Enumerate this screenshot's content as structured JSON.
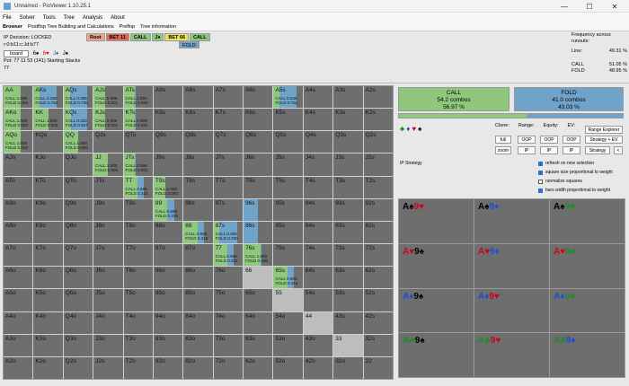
{
  "window": {
    "title": "Unnamed - PioViewer 1.10.25.1",
    "min": "—",
    "max": "☐",
    "close": "✕"
  },
  "menu": [
    "File",
    "Solver",
    "Tools",
    "Tree",
    "Analysis",
    "About"
  ],
  "tabs": [
    "Browser",
    "Postflop Tree Building and Calculations",
    "Preflop",
    "Tree information"
  ],
  "info": {
    "ip_decision": "IP Decision: LOCKED",
    "board_code": "r:0:b11:c:Jd:b77",
    "board_button": "board",
    "suit_codes": [
      "6♠",
      "6♥",
      "J♦",
      "J♠"
    ],
    "pot": "Pot: 77 11 53 (141) Starting Stacks 77"
  },
  "nodes": [
    {
      "label": "Root",
      "color": "#e8a58a"
    },
    {
      "label": "BET 11",
      "color": "#e36a5a"
    },
    {
      "label": "CALL",
      "color": "#8fc77d"
    },
    {
      "label": "J♦",
      "color": "#8fc77d"
    },
    {
      "label": "BET 66",
      "color": "#e8e35a"
    },
    {
      "label": "CALL",
      "color": "#8fc77d"
    }
  ],
  "fold_node": "FOLD",
  "frequency": {
    "title": "Frequency across runouts:",
    "line_label": "Line:",
    "line_val": "49.31 %",
    "call_label": "CALL",
    "call_val": "51.05 %",
    "fold_label": "FOLD",
    "fold_val": "48.95 %"
  },
  "summary": {
    "call_title": "CALL",
    "call_combos": "54.2 combos",
    "call_pct": "56.97 %",
    "fold_title": "FOLD",
    "fold_combos": "41.0 combos",
    "fold_pct": "43.03 %",
    "call_fraction": 0.5697
  },
  "controls": {
    "labels": [
      "Clone:",
      "Range:",
      "Equity:",
      "EV:"
    ],
    "full": "full",
    "zoom": "zoom",
    "oop1": "OOP",
    "oop2": "OOP",
    "oop3": "OOP",
    "ip1": "IP",
    "ip2": "IP",
    "ip3": "IP",
    "range_explorer": "Range Explorer",
    "strategy_ev": "Strategy + EV",
    "strategy": "Strategy",
    "lt": "<",
    "ip_strategy": "IP Strategy",
    "checkboxes": [
      {
        "label": "refresh on new selection",
        "on": true
      },
      {
        "label": "square size proportional to weight",
        "on": true
      },
      {
        "label": "normalize squares",
        "on": false
      },
      {
        "label": "bars width proportional to weight",
        "on": true
      }
    ]
  },
  "hands": [
    [
      "AA",
      "AKs",
      "AQs",
      "AJs",
      "ATs",
      "A9s",
      "A8s",
      "A7s",
      "A6s",
      "A5s",
      "A4s",
      "A3s",
      "A2s"
    ],
    [
      "AKo",
      "KK",
      "KQs",
      "KJs",
      "KTs",
      "K9s",
      "K8s",
      "K7s",
      "K6s",
      "K5s",
      "K4s",
      "K3s",
      "K2s"
    ],
    [
      "AQo",
      "KQo",
      "QQ",
      "QJs",
      "QTs",
      "Q9s",
      "Q8s",
      "Q7s",
      "Q6s",
      "Q5s",
      "Q4s",
      "Q3s",
      "Q2s"
    ],
    [
      "AJo",
      "KJo",
      "QJo",
      "JJ",
      "JTs",
      "J9s",
      "J8s",
      "J7s",
      "J6s",
      "J5s",
      "J4s",
      "J3s",
      "J2s"
    ],
    [
      "ATo",
      "KTo",
      "QTo",
      "JTo",
      "TT",
      "T9s",
      "T8s",
      "T7s",
      "T6s",
      "T5s",
      "T4s",
      "T3s",
      "T2s"
    ],
    [
      "A9o",
      "K9o",
      "Q9o",
      "J9o",
      "T9o",
      "99",
      "98s",
      "97s",
      "96s",
      "95s",
      "94s",
      "93s",
      "92s"
    ],
    [
      "A8o",
      "K8o",
      "Q8o",
      "J8o",
      "T8o",
      "98o",
      "88",
      "87s",
      "86s",
      "85s",
      "84s",
      "83s",
      "82s"
    ],
    [
      "A7o",
      "K7o",
      "Q7o",
      "J7o",
      "T7o",
      "97o",
      "87o",
      "77",
      "76s",
      "75s",
      "74s",
      "73s",
      "72s"
    ],
    [
      "A6o",
      "K6o",
      "Q6o",
      "J6o",
      "T6o",
      "96o",
      "86o",
      "76o",
      "66",
      "65s",
      "64s",
      "63s",
      "62s"
    ],
    [
      "A5o",
      "K5o",
      "Q5o",
      "J5o",
      "T5o",
      "95o",
      "85o",
      "75o",
      "65o",
      "55",
      "54s",
      "53s",
      "52s"
    ],
    [
      "A4o",
      "K4o",
      "Q4o",
      "J4o",
      "T4o",
      "94o",
      "84o",
      "74o",
      "64o",
      "54o",
      "44",
      "43s",
      "42s"
    ],
    [
      "A3o",
      "K3o",
      "Q3o",
      "J3o",
      "T3o",
      "93o",
      "83o",
      "73o",
      "63o",
      "53o",
      "43o",
      "33",
      "32s"
    ],
    [
      "A2o",
      "K2o",
      "Q2o",
      "J2o",
      "T2o",
      "92o",
      "82o",
      "72o",
      "62o",
      "52o",
      "42o",
      "32o",
      "22"
    ]
  ],
  "strategies": {
    "0-0": {
      "call": 1.0,
      "fold": 0.0,
      "weight": 0.6,
      "text": [
        "CALL 1.000",
        "FOLD 0.000"
      ]
    },
    "0-1": {
      "call": 0.25,
      "fold": 0.75,
      "weight": 0.8,
      "text": [
        "CALL 0.250",
        "FOLD 0.750"
      ]
    },
    "0-2": {
      "call": 0.265,
      "fold": 0.735,
      "weight": 0.8,
      "text": [
        "CALL 0.265",
        "FOLD 0.735"
      ]
    },
    "0-3": {
      "call": 0.999,
      "fold": 0.001,
      "weight": 0.4,
      "text": [
        "CALL 0.999",
        "FOLD 0.001"
      ]
    },
    "0-4": {
      "call": 1.0,
      "fold": 0.0,
      "weight": 0.4,
      "text": [
        "CALL 1.000",
        "FOLD 0.000"
      ]
    },
    "0-9": {
      "call": 0.248,
      "fold": 0.752,
      "weight": 0.8,
      "text": [
        "CALL 0.248",
        "FOLD 0.752"
      ]
    },
    "1-0": {
      "call": 1.0,
      "fold": 0.0,
      "weight": 0.6,
      "text": [
        "CALL 1.000",
        "FOLD 0.000"
      ]
    },
    "1-1": {
      "call": 1.0,
      "fold": 0.0,
      "weight": 0.5,
      "text": [
        "CALL 1.000",
        "FOLD 0.000"
      ]
    },
    "1-2": {
      "call": 0.333,
      "fold": 0.667,
      "weight": 0.8,
      "text": [
        "CALL 0.333",
        "FOLD 0.667"
      ]
    },
    "1-3": {
      "call": 0.999,
      "fold": 0.001,
      "weight": 0.4,
      "text": [
        "CALL 0.999",
        "FOLD 0.001"
      ]
    },
    "1-4": {
      "call": 0.999,
      "fold": 0.001,
      "weight": 0.4,
      "text": [
        "CALL 0.999",
        "FOLD 0.001"
      ]
    },
    "2-0": {
      "call": 1.0,
      "fold": 0.0,
      "weight": 0.6,
      "text": [
        "CALL 1.000",
        "FOLD 0.000"
      ]
    },
    "2-2": {
      "call": 1.0,
      "fold": 0.0,
      "weight": 0.5,
      "text": [
        "CALL 1.000",
        "FOLD 0.000"
      ]
    },
    "3-3": {
      "call": 1.0,
      "fold": 0.0,
      "weight": 0.5,
      "text": [
        "CALL 1.000",
        "FOLD 0.000"
      ]
    },
    "3-4": {
      "call": 0.999,
      "fold": 0.001,
      "weight": 0.4,
      "text": [
        "CALL 0.999",
        "FOLD 0.001"
      ]
    },
    "4-4": {
      "call": 0.685,
      "fold": 0.315,
      "weight": 0.7,
      "text": [
        "CALL 0.685",
        "FOLD 0.315"
      ]
    },
    "4-5": {
      "call": 1.0,
      "fold": 0.0,
      "weight": 0.4,
      "text": [
        "CALL 1.000",
        "FOLD 0.000"
      ]
    },
    "5-5": {
      "call": 0.685,
      "fold": 0.315,
      "weight": 0.7,
      "text": [
        "CALL 0.685",
        "FOLD 0.315"
      ]
    },
    "6-6": {
      "call": 0.685,
      "fold": 0.315,
      "weight": 0.7,
      "text": [
        "CALL 0.685",
        "FOLD 0.315"
      ]
    },
    "6-7": {
      "call": 0.25,
      "fold": 0.75,
      "weight": 0.8,
      "text": [
        "CALL 0.250",
        "FOLD 0.750"
      ]
    },
    "7-7": {
      "call": 0.685,
      "fold": 0.315,
      "weight": 0.7,
      "text": [
        "CALL 0.685",
        "FOLD 0.315"
      ]
    },
    "7-8": {
      "call": 1.0,
      "fold": 0.0,
      "weight": 0.6,
      "text": [
        "CALL 1.000",
        "FOLD 0.000"
      ]
    },
    "8-9": {
      "call": 0.685,
      "fold": 0.315,
      "weight": 0.7,
      "text": [
        "CALL 0.685",
        "FOLD 0.315"
      ]
    }
  },
  "light_cells": [
    "8-8",
    "9-9",
    "10-10",
    "11-11"
  ],
  "blue_only": [
    "5-8",
    "6-8"
  ],
  "combos": [
    {
      "cards": [
        {
          "t": "A♠",
          "c": "#000"
        },
        {
          "t": "9♥",
          "c": "#d0021b"
        }
      ]
    },
    {
      "cards": [
        {
          "t": "A♠",
          "c": "#000"
        },
        {
          "t": "9♦",
          "c": "#1b4fd0"
        }
      ]
    },
    {
      "cards": [
        {
          "t": "A♠",
          "c": "#000"
        },
        {
          "t": "9♣",
          "c": "#1f8a2b"
        }
      ]
    },
    {
      "cards": [
        {
          "t": "A♥",
          "c": "#d0021b"
        },
        {
          "t": "9♠",
          "c": "#000"
        }
      ]
    },
    {
      "cards": [
        {
          "t": "A♥",
          "c": "#d0021b"
        },
        {
          "t": "9♦",
          "c": "#1b4fd0"
        }
      ]
    },
    {
      "cards": [
        {
          "t": "A♥",
          "c": "#d0021b"
        },
        {
          "t": "9♣",
          "c": "#1f8a2b"
        }
      ]
    },
    {
      "cards": [
        {
          "t": "A♦",
          "c": "#1b4fd0"
        },
        {
          "t": "9♠",
          "c": "#000"
        }
      ]
    },
    {
      "cards": [
        {
          "t": "A♦",
          "c": "#1b4fd0"
        },
        {
          "t": "9♥",
          "c": "#d0021b"
        }
      ]
    },
    {
      "cards": [
        {
          "t": "A♦",
          "c": "#1b4fd0"
        },
        {
          "t": "9♣",
          "c": "#1f8a2b"
        }
      ]
    },
    {
      "cards": [
        {
          "t": "A♣",
          "c": "#1f8a2b"
        },
        {
          "t": "9♠",
          "c": "#000"
        }
      ]
    },
    {
      "cards": [
        {
          "t": "A♣",
          "c": "#1f8a2b"
        },
        {
          "t": "9♥",
          "c": "#d0021b"
        }
      ]
    },
    {
      "cards": [
        {
          "t": "A♣",
          "c": "#1f8a2b"
        },
        {
          "t": "9♦",
          "c": "#1b4fd0"
        }
      ]
    }
  ],
  "suit_filter": [
    {
      "t": "♣",
      "c": "#1f8a2b"
    },
    {
      "t": "♦",
      "c": "#1b4fd0"
    },
    {
      "t": "♥",
      "c": "#d0021b"
    },
    {
      "t": "♠",
      "c": "#000"
    }
  ]
}
